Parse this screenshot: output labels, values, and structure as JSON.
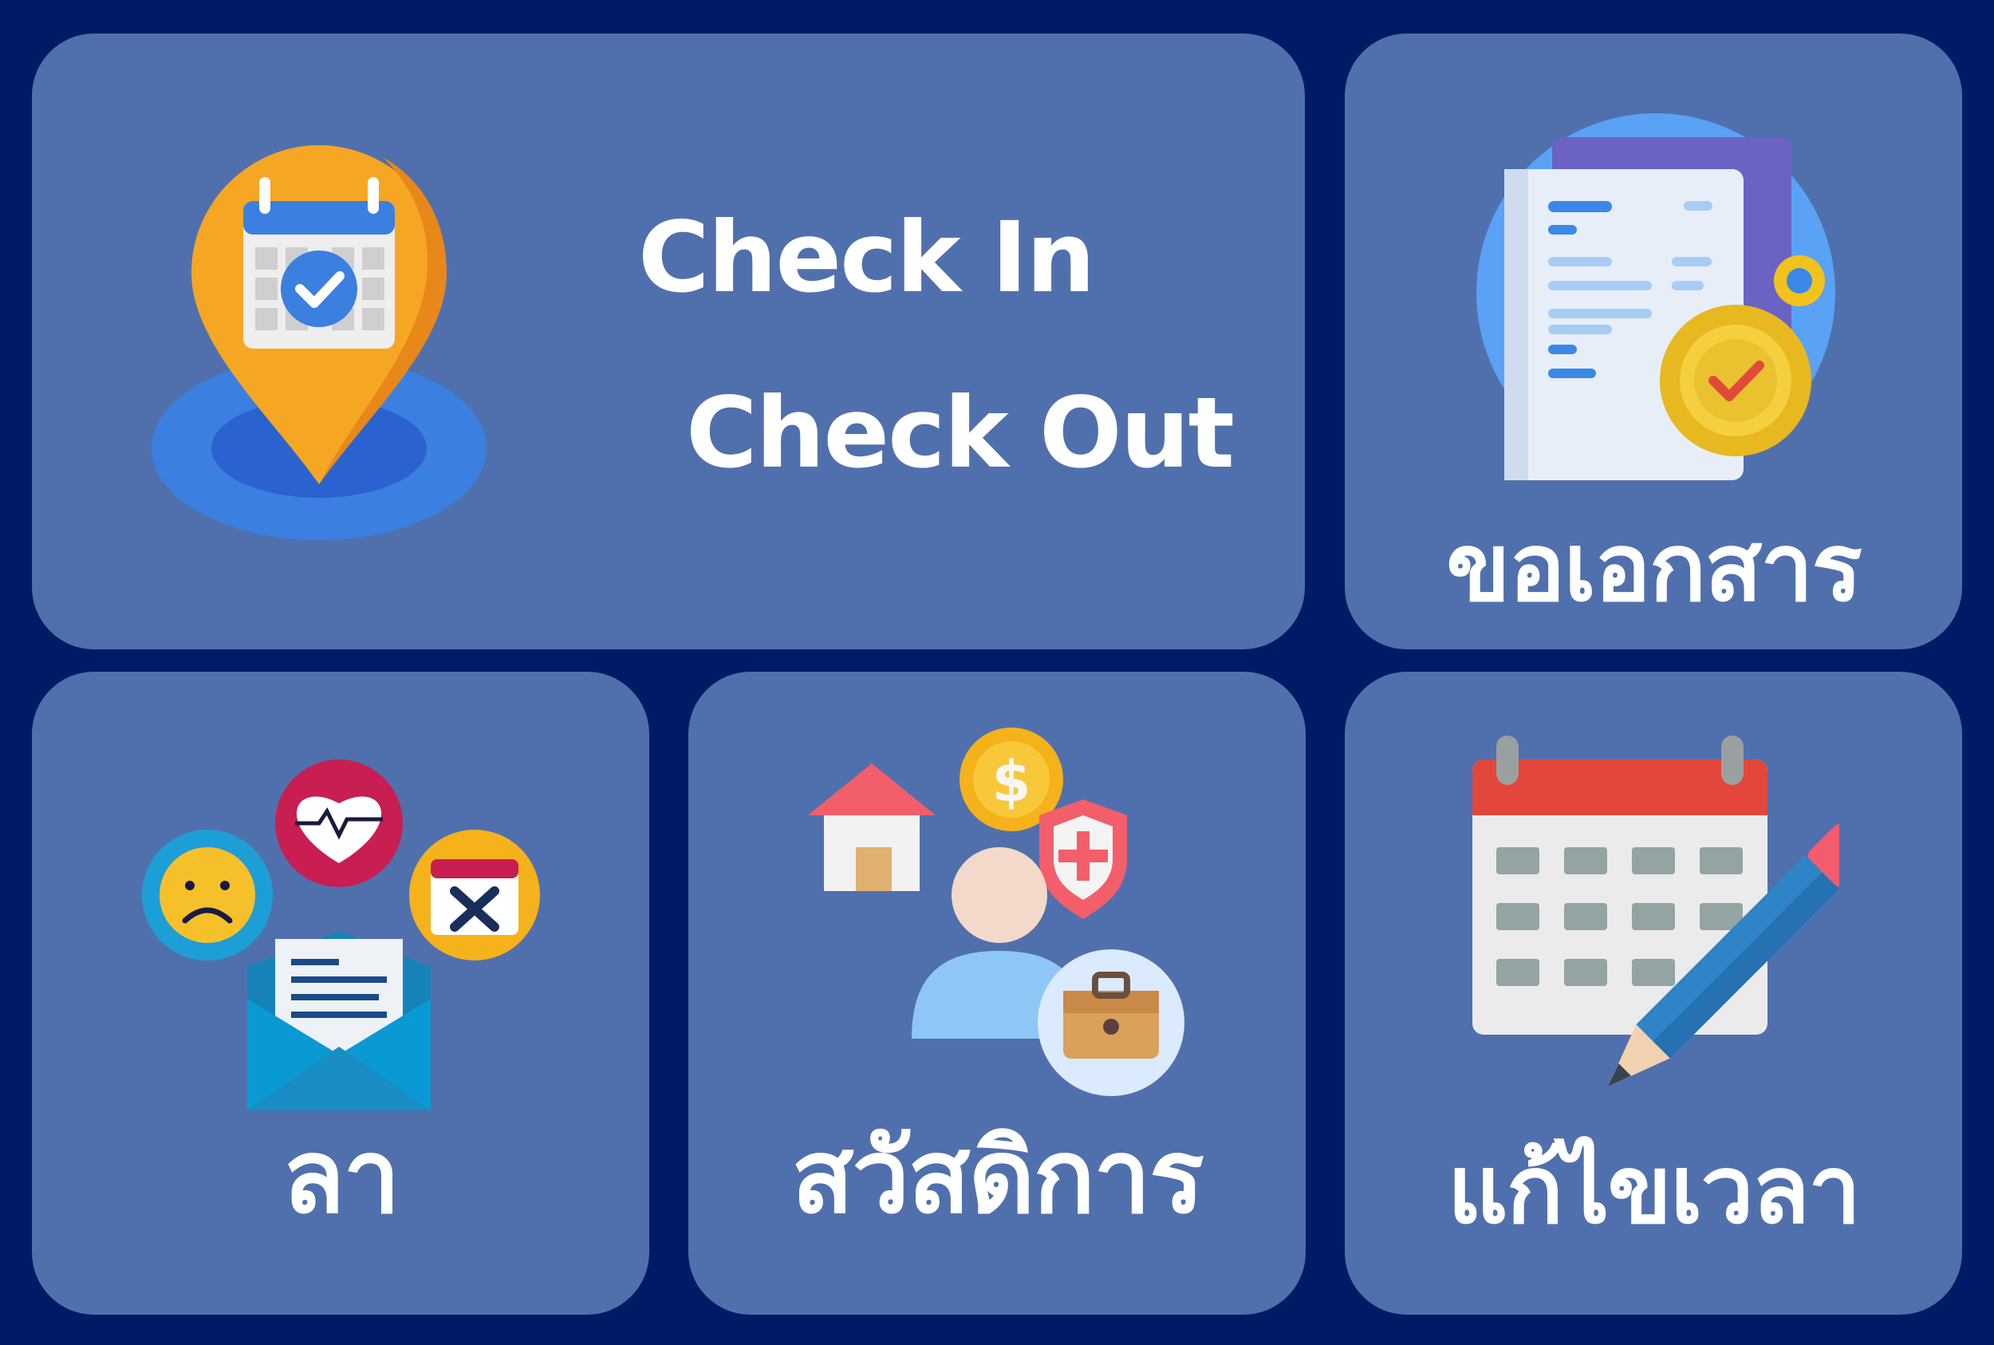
{
  "tiles": {
    "checkin": {
      "line1": "Check In",
      "line2": "Check Out",
      "icon": "location-pin-calendar-icon"
    },
    "documents": {
      "label": "ขอเอกสาร",
      "icon": "document-gear-check-icon"
    },
    "leave": {
      "label": "ลา",
      "icon": "envelope-leave-reasons-icon"
    },
    "welfare": {
      "label": "สวัสดิการ",
      "icon": "employee-benefits-icon"
    },
    "time_edit": {
      "label": "แก้ไขเวลา",
      "icon": "calendar-pencil-icon"
    }
  },
  "colors": {
    "background": "#001b66",
    "tile": "#5070ad",
    "text": "#ffffff"
  }
}
